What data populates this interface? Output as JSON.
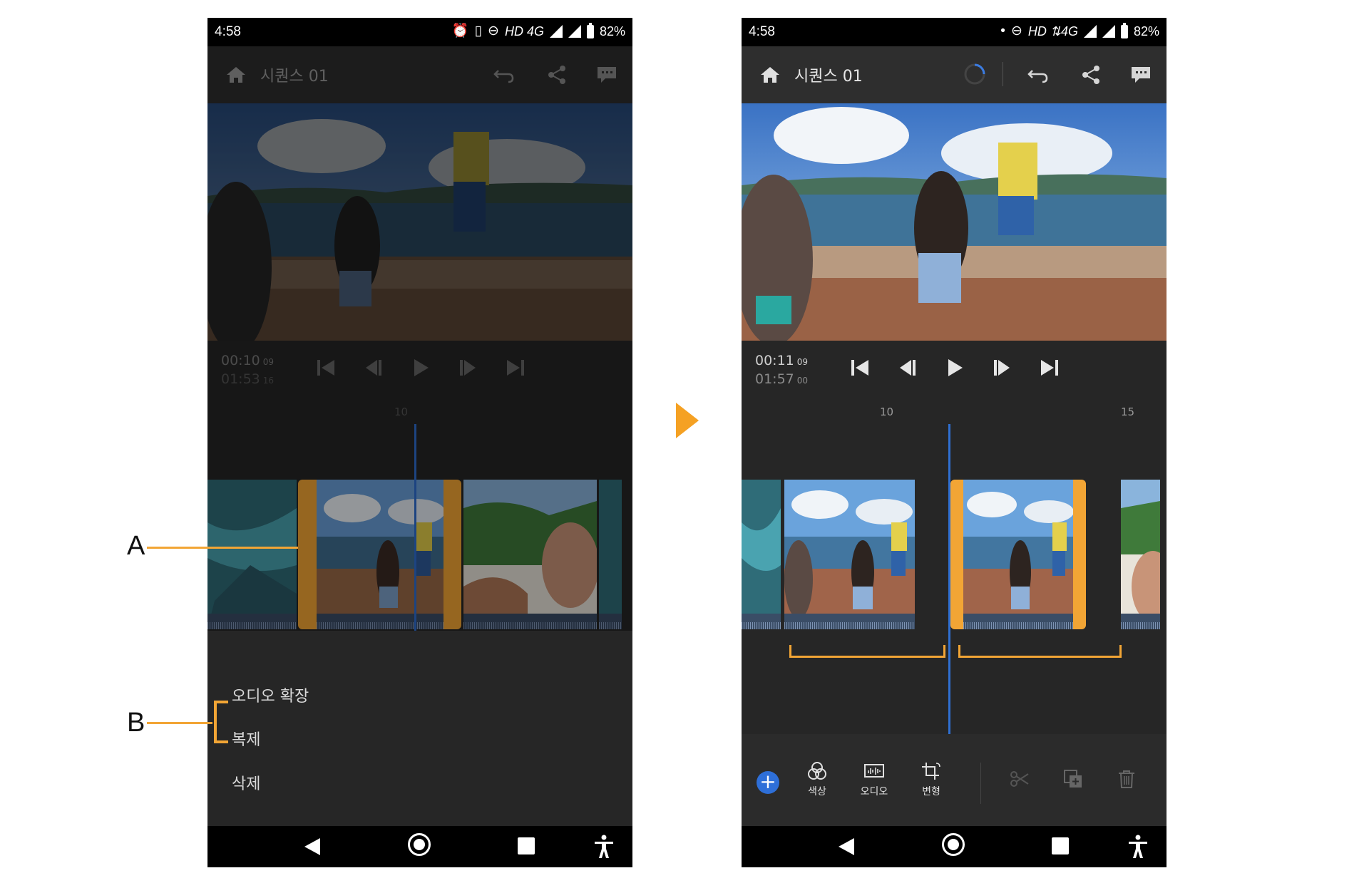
{
  "left_phone": {
    "status": {
      "time": "4:58",
      "network": "HD 4G",
      "battery": "82%"
    },
    "header": {
      "title": "시퀀스 01"
    },
    "transport": {
      "current": "00:10",
      "current_frames": "09",
      "total": "01:53",
      "total_frames": "16"
    },
    "ruler": [
      "10"
    ],
    "menu": [
      "오디오 확장",
      "복제",
      "삭제"
    ]
  },
  "right_phone": {
    "status": {
      "time": "4:58",
      "network": "HD ⇅4G",
      "battery": "82%"
    },
    "header": {
      "title": "시퀀스 01"
    },
    "transport": {
      "current": "00:11",
      "current_frames": "09",
      "total": "01:57",
      "total_frames": "00"
    },
    "ruler": [
      "10",
      "15"
    ],
    "toolbar": {
      "color": "색상",
      "audio": "오디오",
      "transform": "변형"
    }
  },
  "callouts": {
    "a": "A",
    "b": "B"
  },
  "colors": {
    "accent": "#f2a535",
    "playhead": "#2f6fd1",
    "arrow": "#f5a123"
  }
}
